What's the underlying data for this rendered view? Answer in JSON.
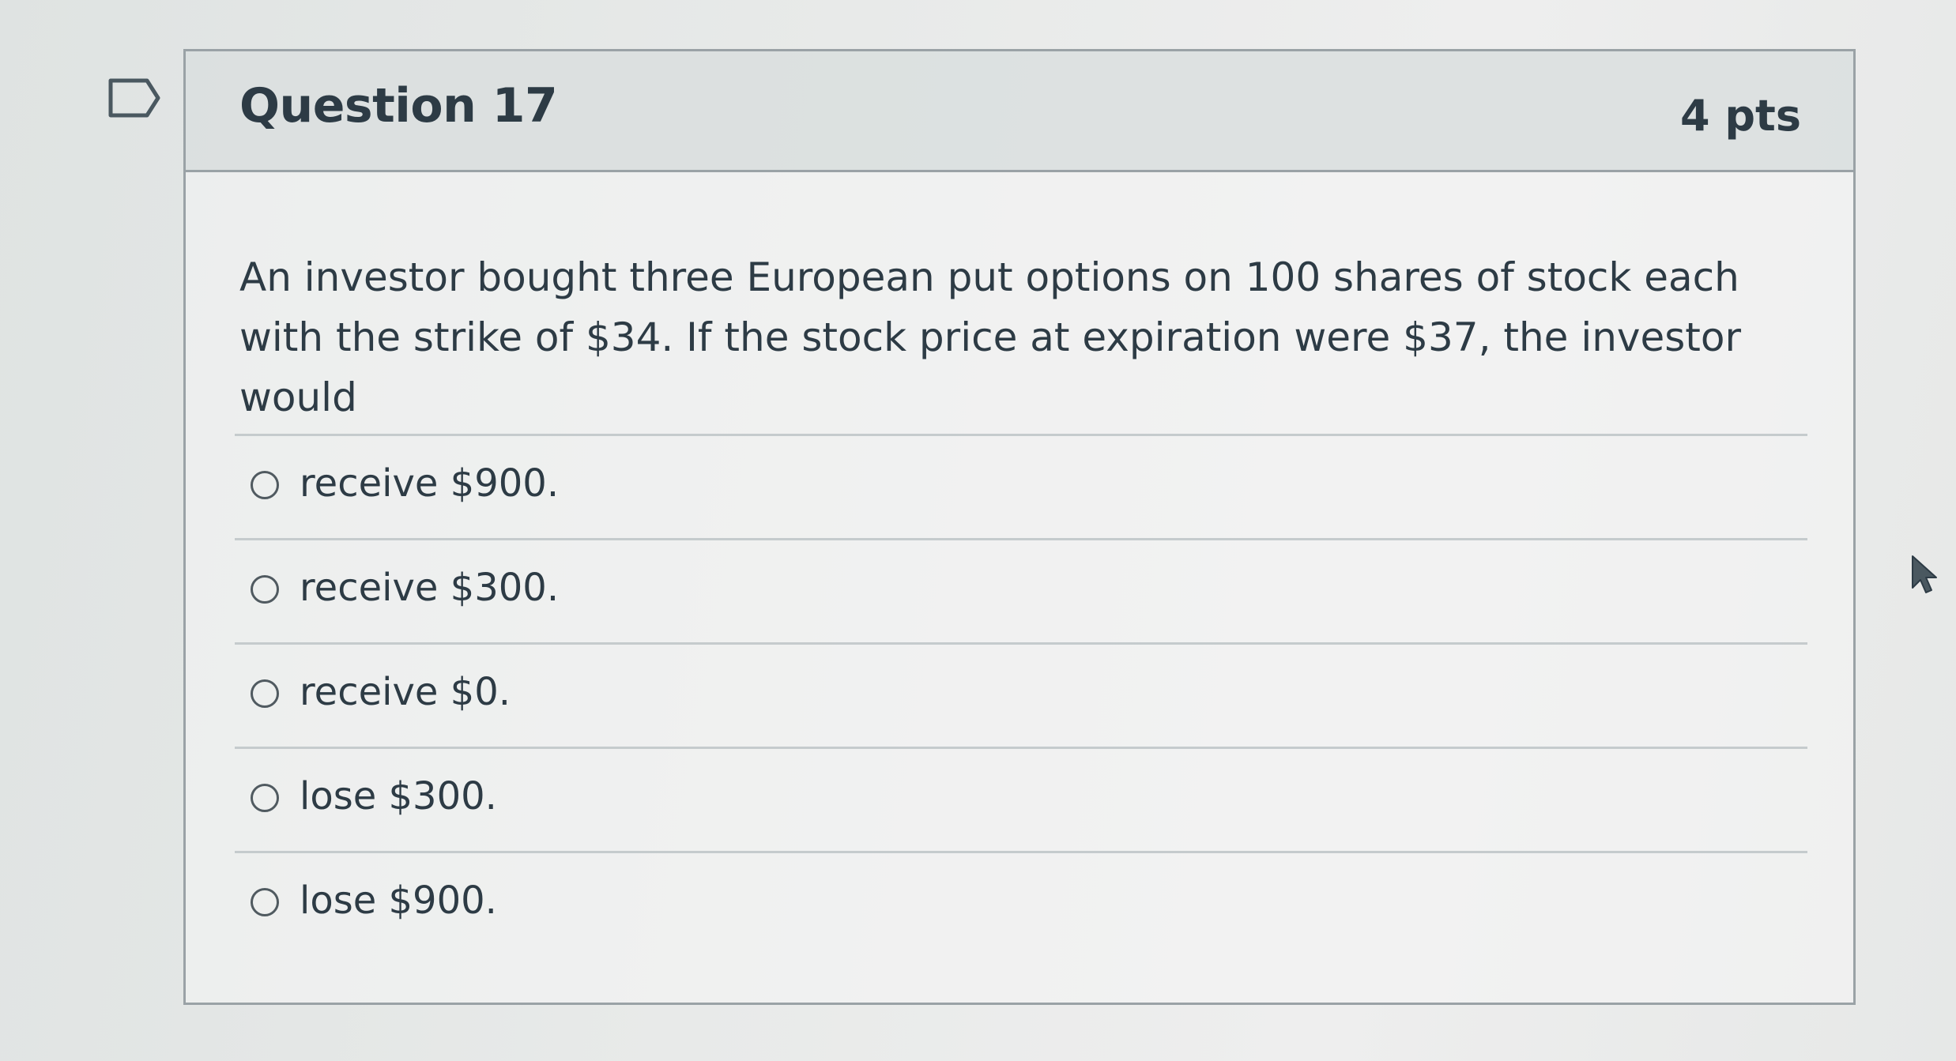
{
  "question": {
    "title": "Question 17",
    "points": "4 pts",
    "text": "An investor bought three European put options on 100 shares of stock each with the strike of $34. If the stock price at expiration were $37, the investor would"
  },
  "answers": [
    {
      "label": "receive $900."
    },
    {
      "label": "receive $300."
    },
    {
      "label": "receive $0."
    },
    {
      "label": "lose $300."
    },
    {
      "label": "lose $900."
    }
  ],
  "icons": {
    "bookmark": "bookmark-flag-icon",
    "cursor": "mouse-pointer-icon"
  }
}
